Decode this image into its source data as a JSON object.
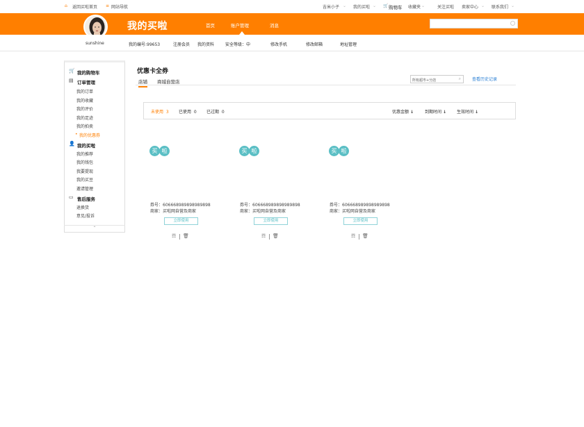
{
  "topbar": {
    "left": {
      "home_link": "返回买啦首页",
      "nav_link": "网站导航"
    },
    "right": {
      "user": "吉米小子",
      "my_maila": "我的买啦",
      "cart": "购物车",
      "favorites": "收藏夹",
      "follow": "关注买啦",
      "seller_center": "卖家中心",
      "contact": "联系我们"
    }
  },
  "header": {
    "brand": "我的买啦",
    "username": "sunshine",
    "nav": [
      "首页",
      "账户管理",
      "消息"
    ],
    "active_nav_index": 1,
    "search": {
      "placeholder": ""
    }
  },
  "subnav": {
    "member_no": "我的编号:99653",
    "items": [
      "注册会员",
      "我的资料",
      "安全等级：中",
      "修改手机",
      "修改邮箱",
      "地址管理"
    ]
  },
  "sidebar": {
    "sections": [
      {
        "title": "我的购物车",
        "icon": "cart-icon",
        "items": []
      },
      {
        "title": "订单管理",
        "icon": "document-icon",
        "items": [
          "我的订单",
          "我的收藏",
          "我的评价",
          "我的足迹",
          "我的拍卖",
          "我的优惠券"
        ]
      },
      {
        "title": "我的买啦",
        "icon": "user-icon",
        "items": [
          "我的推荐",
          "我的钱包",
          "我要提现",
          "我的买豆",
          "邀请管理"
        ]
      },
      {
        "title": "售后服务",
        "icon": "card-icon",
        "items": [
          "退换货",
          "意见/投诉"
        ]
      }
    ],
    "active_item": "我的优惠券",
    "collapse_glyph": "⌃"
  },
  "main": {
    "title": "优惠卡全券",
    "tabs": [
      "店铺",
      "商城自营店"
    ],
    "active_tab_index": 0,
    "shop_select": "所有超市+分店",
    "history_link": "查看历史记录",
    "filters": [
      {
        "label": "未使用",
        "count": "3"
      },
      {
        "label": "已使用",
        "count": "0"
      },
      {
        "label": "已过期",
        "count": "0"
      }
    ],
    "sorts": [
      "优惠金额",
      "到期时间",
      "生效时间"
    ]
  },
  "coupons": [
    {
      "logo": [
        "买",
        "啦"
      ],
      "code_label": "券号：",
      "code": "606668989898989898",
      "merchant_label": "商家：",
      "merchant": "买啦网自营及商家",
      "button": "立即使用"
    },
    {
      "logo": [
        "买",
        "啦"
      ],
      "code_label": "券号：",
      "code": "606668989898989898",
      "merchant_label": "商家：",
      "merchant": "买啦网自营及商家",
      "button": "立即使用"
    },
    {
      "logo": [
        "买",
        "啦"
      ],
      "code_label": "券号：",
      "code": "606668989898989898",
      "merchant_label": "商家：",
      "merchant": "买啦网自营及商家",
      "button": "立即使用"
    }
  ],
  "colors": {
    "accent": "#ff7f00",
    "teal": "#5bbfc5",
    "link": "#2a7fd4"
  }
}
